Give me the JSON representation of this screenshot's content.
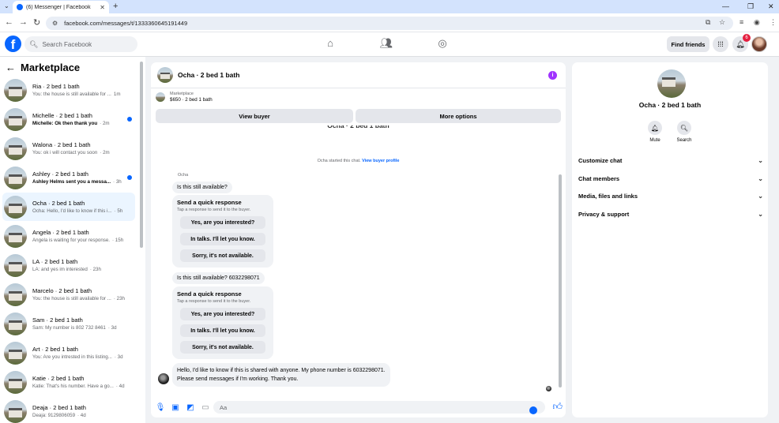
{
  "browser": {
    "tab_title": "(6) Messenger | Facebook",
    "url": "facebook.com/messages/t/1333360645191449"
  },
  "fb": {
    "search_placeholder": "Search Facebook",
    "find_friends": "Find friends",
    "notification_count": "6"
  },
  "sidebar": {
    "title": "Marketplace",
    "conversations": [
      {
        "name": "Ria · 2 bed 1 bath",
        "snippet": "You: the house is still available for ...",
        "time": "1m",
        "unread": false,
        "active": false
      },
      {
        "name": "Michelle · 2 bed 1 bath",
        "snippet": "Michelle: Ok then thank you",
        "time": "· 2m",
        "unread": true,
        "active": false
      },
      {
        "name": "Walona · 2 bed 1 bath",
        "snippet": "You: ok i will contact you soon",
        "time": "· 2m",
        "unread": false,
        "active": false
      },
      {
        "name": "Ashley · 2 bed 1 bath",
        "snippet": "Ashley Helms sent you a messa...",
        "time": "· 3h",
        "unread": true,
        "active": false
      },
      {
        "name": "Ocha · 2 bed 1 bath",
        "snippet": "Ocha: Hello, I'd like to know if this i...",
        "time": "· 5h",
        "unread": false,
        "active": true
      },
      {
        "name": "Angela · 2 bed 1 bath",
        "snippet": "Angela is waiting for your response.",
        "time": "· 15h",
        "unread": false,
        "active": false
      },
      {
        "name": "LA · 2 bed 1 bath",
        "snippet": "LA: and yes im interested",
        "time": "· 23h",
        "unread": false,
        "active": false
      },
      {
        "name": "Marcelo · 2 bed 1 bath",
        "snippet": "You: the house is still available for ...",
        "time": "· 23h",
        "unread": false,
        "active": false
      },
      {
        "name": "Sam · 2 bed 1 bath",
        "snippet": "Sam: My number is 802 732 8461",
        "time": "· 3d",
        "unread": false,
        "active": false
      },
      {
        "name": "Art · 2 bed 1 bath",
        "snippet": "You: Are you intrested in this listing...",
        "time": "· 3d",
        "unread": false,
        "active": false
      },
      {
        "name": "Katie · 2 bed 1 bath",
        "snippet": "Katie: That's his number. Have a go...",
        "time": "· 4d",
        "unread": false,
        "active": false
      },
      {
        "name": "Deaja · 2 bed 1 bath",
        "snippet": "Deaja: 9129806059",
        "time": "· 4d",
        "unread": false,
        "active": false
      }
    ]
  },
  "chat": {
    "title": "Ocha · 2 bed 1 bath",
    "listing_label": "Marketplace",
    "listing_detail": "$650 · 2 bed 1 bath",
    "view_buyer": "View buyer",
    "more_options": "More options",
    "cut_title": "Ocha · 2 bed 1 bath",
    "system_text": "Ocha started this chat.",
    "system_link": "View buyer profile",
    "sender_name": "Ocha",
    "msg1": "Is this still available?",
    "quick1": {
      "title": "Send a quick response",
      "sub": "Tap a response to send it to the buyer.",
      "options": [
        "Yes, are you interested?",
        "In talks. I'll let you know.",
        "Sorry, it's not available."
      ]
    },
    "msg2": "Is this still available? 6032298071",
    "quick2": {
      "title": "Send a quick response",
      "sub": "Tap a response to send it to the buyer.",
      "options": [
        "Yes, are you interested?",
        "In talks. I'll let you know.",
        "Sorry, it's not available."
      ]
    },
    "msg3_line1": "Hello, I'd like to know if this is shared with anyone. My phone number is 6032298071.",
    "msg3_line2": "Please send messages if I'm working. Thank you.",
    "compose_placeholder": "Aa"
  },
  "info_panel": {
    "name": "Ocha · 2 bed 1 bath",
    "mute": "Mute",
    "search": "Search",
    "sections": [
      "Customize chat",
      "Chat members",
      "Media, files and links",
      "Privacy & support"
    ]
  }
}
